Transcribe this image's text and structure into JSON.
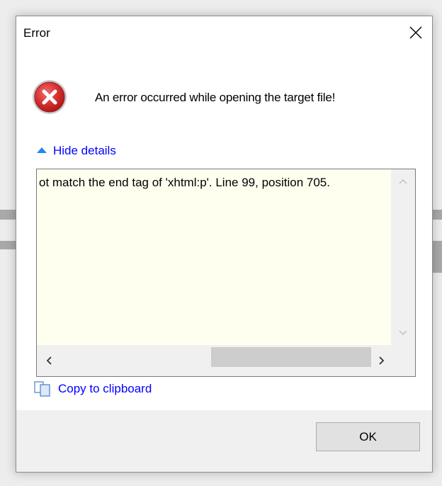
{
  "dialog": {
    "title": "Error",
    "message": "An error occurred while opening the target file!",
    "details_toggle_label": "Hide details",
    "details_text": "ot match the end tag of 'xhtml:p'. Line 99, position 705.",
    "copy_label": "Copy to clipboard",
    "ok_label": "OK"
  },
  "icons": {
    "close": "close-icon",
    "error": "error-icon",
    "collapse": "triangle-up-icon",
    "copy": "copy-icon"
  },
  "colors": {
    "link": "#0000ff",
    "details_bg": "#fffff0",
    "error_red": "#d22d2d",
    "footer_bg": "#f0f0f0"
  }
}
